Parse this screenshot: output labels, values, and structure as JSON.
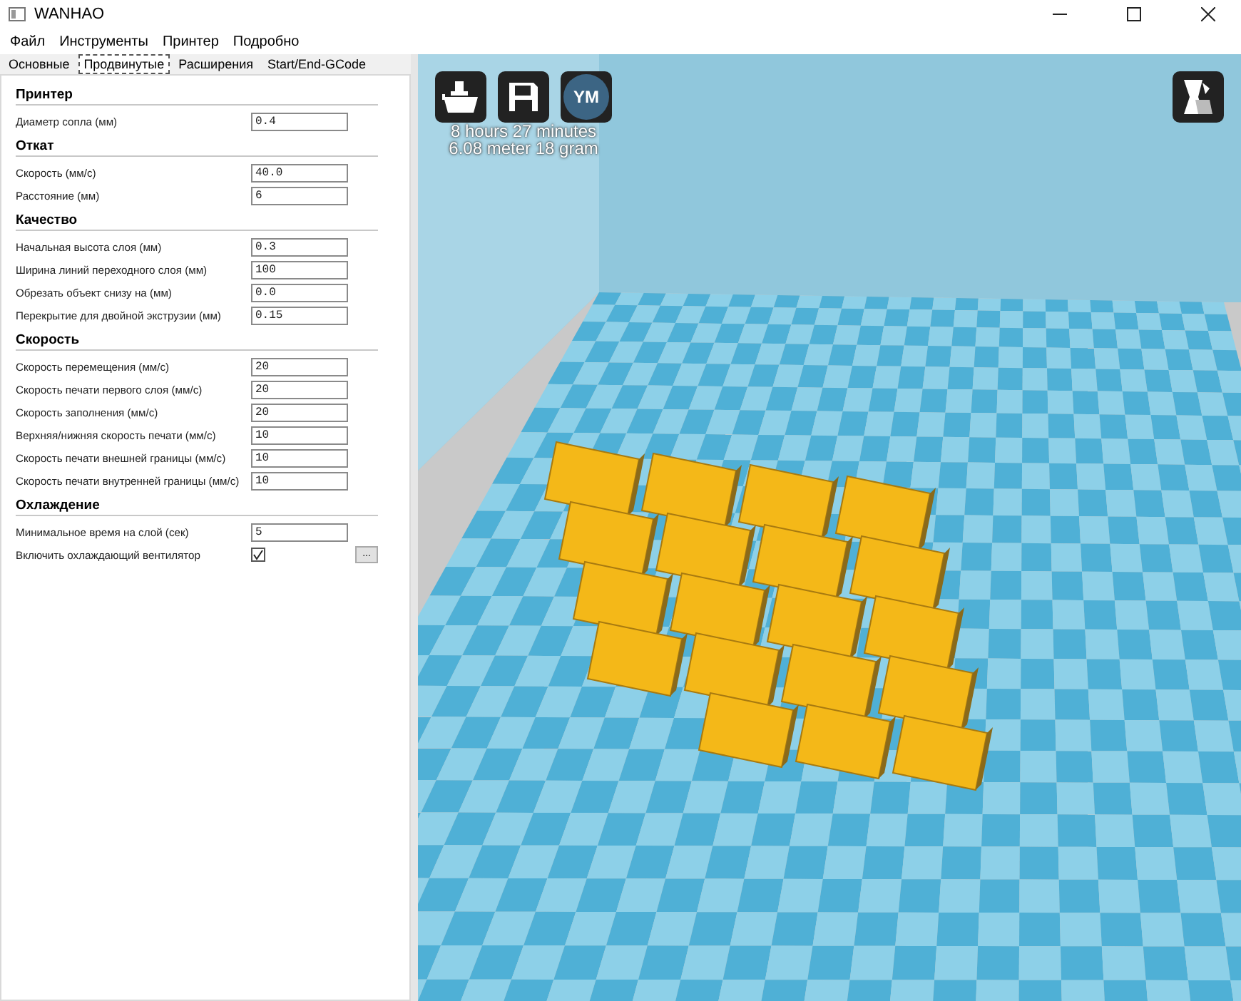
{
  "window": {
    "title": "WANHAO"
  },
  "menu": [
    "Файл",
    "Инструменты",
    "Принтер",
    "Подробно"
  ],
  "tabs": [
    {
      "label": "Основные",
      "selected": false
    },
    {
      "label": "Продвинутые",
      "selected": true
    },
    {
      "label": "Расширения",
      "selected": false
    },
    {
      "label": "Start/End-GCode",
      "selected": false
    }
  ],
  "sections": [
    {
      "title": "Принтер",
      "settings": [
        {
          "kind": "input",
          "label": "Диаметр сопла (мм)",
          "value": "0.4"
        }
      ]
    },
    {
      "title": "Откат",
      "settings": [
        {
          "kind": "input",
          "label": "Скорость (мм/с)",
          "value": "40.0"
        },
        {
          "kind": "input",
          "label": "Расстояние (мм)",
          "value": "6"
        }
      ]
    },
    {
      "title": "Качество",
      "settings": [
        {
          "kind": "input",
          "label": "Начальная высота слоя (мм)",
          "value": "0.3"
        },
        {
          "kind": "input",
          "label": "Ширина линий переходного слоя (мм)",
          "value": "100"
        },
        {
          "kind": "input",
          "label": "Обрезать объект снизу на (мм)",
          "value": "0.0"
        },
        {
          "kind": "input",
          "label": "Перекрытие для двойной экструзии (мм)",
          "value": "0.15"
        }
      ]
    },
    {
      "title": "Скорость",
      "settings": [
        {
          "kind": "input",
          "label": "Скорость перемещения (мм/с)",
          "value": "20"
        },
        {
          "kind": "input",
          "label": "Скорость печати первого слоя (мм/с)",
          "value": "20"
        },
        {
          "kind": "input",
          "label": "Скорость заполнения (мм/с)",
          "value": "20"
        },
        {
          "kind": "input",
          "label": "Верхняя/нижняя скорость печати (мм/с)",
          "value": "10"
        },
        {
          "kind": "input",
          "label": "Скорость печати внешней границы (мм/с)",
          "value": "10"
        },
        {
          "kind": "input",
          "label": "Скорость печати внутренней границы (мм/с)",
          "value": "10"
        }
      ]
    },
    {
      "title": "Охлаждение",
      "settings": [
        {
          "kind": "input",
          "label": "Минимальное время на слой (сек)",
          "value": "5"
        },
        {
          "kind": "checkbox",
          "label": "Включить охлаждающий вентилятор",
          "checked": true,
          "button": "..."
        }
      ]
    }
  ],
  "viewport": {
    "logo_text": "YM",
    "print_time": "8 hours 27 minutes",
    "material": "6.08 meter 18 gram"
  }
}
